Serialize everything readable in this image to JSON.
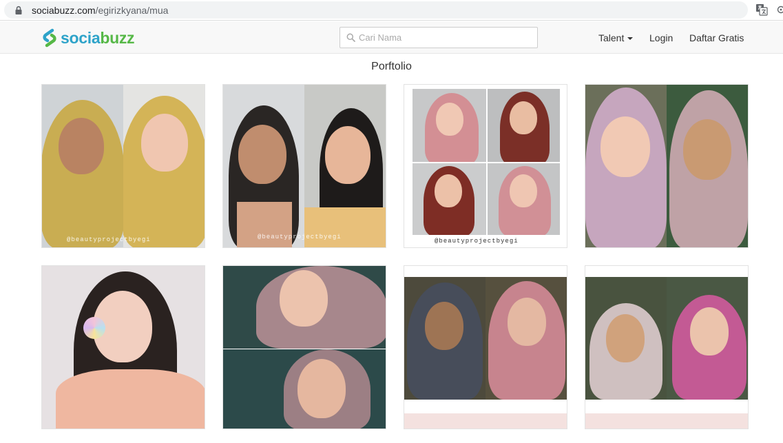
{
  "browser": {
    "url_host": "sociabuzz.com",
    "url_path": "/egirizkyana/mua"
  },
  "navbar": {
    "logo_part1": "socia",
    "logo_part2": "buzz",
    "search_placeholder": "Cari Nama",
    "talent_label": "Talent",
    "login_label": "Login",
    "daftar_label": "Daftar Gratis"
  },
  "portfolio": {
    "title": "Porftolio",
    "watermark": "@beautyprojectbyegi",
    "items": [
      {
        "alt": ""
      },
      {
        "alt": ""
      },
      {
        "alt": ""
      },
      {
        "alt": ""
      },
      {
        "alt": ""
      },
      {
        "alt": ""
      },
      {
        "alt": ""
      },
      {
        "alt": ""
      }
    ]
  },
  "colors": {
    "logo_blue": "#2ea3c9",
    "logo_green": "#56b847",
    "navbar_bg": "#f8f8f8"
  }
}
